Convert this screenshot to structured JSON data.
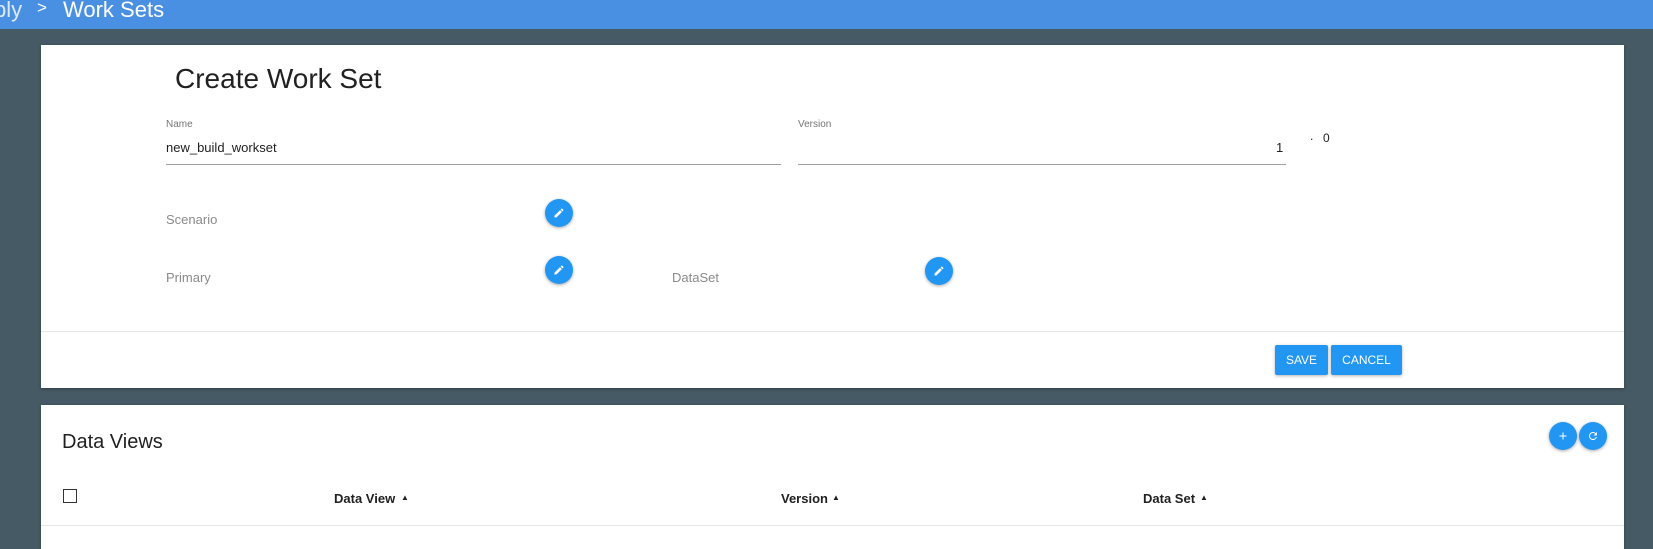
{
  "breadcrumb": {
    "previous": "ply",
    "separator": ">",
    "current": "Work Sets"
  },
  "form": {
    "title": "Create Work Set",
    "name": {
      "label": "Name",
      "value": "new_build_workset"
    },
    "version": {
      "label": "Version",
      "major": "1",
      "separator": ".",
      "minor": "0"
    },
    "scenario_label": "Scenario",
    "primary_label": "Primary",
    "dataset_label": "DataSet",
    "save_label": "SAVE",
    "cancel_label": "CANCEL"
  },
  "data_views": {
    "title": "Data Views",
    "columns": [
      "Data View",
      "Version",
      "Data Set"
    ],
    "sort_indicator": "▲"
  },
  "colors": {
    "topbar": "#4a90e2",
    "background": "#455a64",
    "accent": "#2196f3"
  },
  "icons": [
    "chevron-right-icon",
    "pencil-icon",
    "plus-icon",
    "refresh-icon"
  ]
}
